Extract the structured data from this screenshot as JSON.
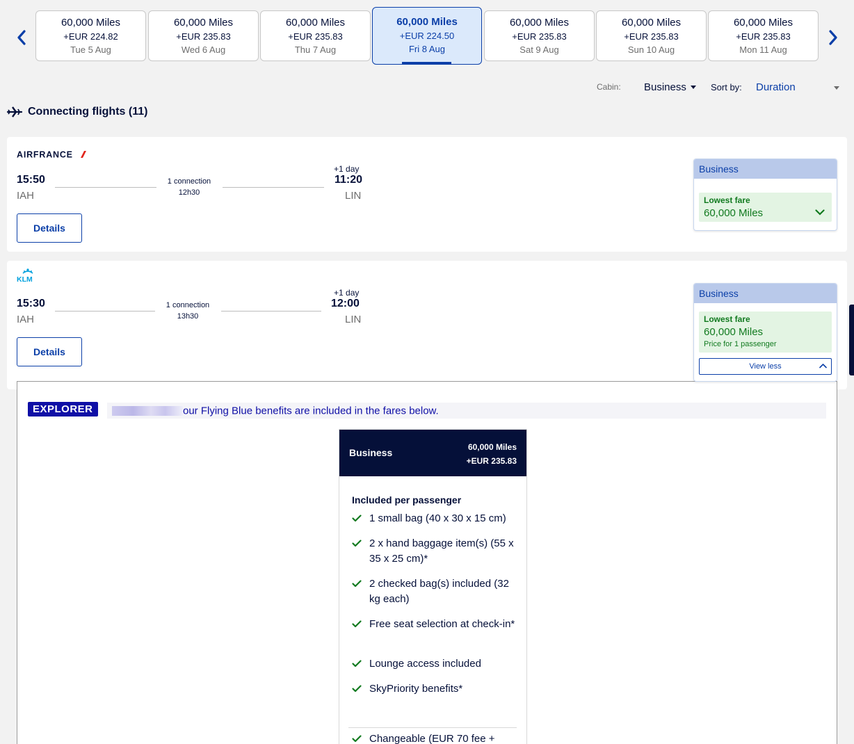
{
  "dates": [
    {
      "miles": "60,000 Miles",
      "eur": "+EUR 224.82",
      "day": "Tue 5 Aug"
    },
    {
      "miles": "60,000 Miles",
      "eur": "+EUR 235.83",
      "day": "Wed 6 Aug"
    },
    {
      "miles": "60,000 Miles",
      "eur": "+EUR 235.83",
      "day": "Thu 7 Aug"
    },
    {
      "miles": "60,000 Miles",
      "eur": "+EUR 224.50",
      "day": "Fri 8 Aug"
    },
    {
      "miles": "60,000 Miles",
      "eur": "+EUR 235.83",
      "day": "Sat 9 Aug"
    },
    {
      "miles": "60,000 Miles",
      "eur": "+EUR 235.83",
      "day": "Sun 10 Aug"
    },
    {
      "miles": "60,000 Miles",
      "eur": "+EUR 235.83",
      "day": "Mon 11 Aug"
    }
  ],
  "controls": {
    "cabin_label": "Cabin:",
    "cabin_value": "Business",
    "sort_label": "Sort by:",
    "sort_value": "Duration"
  },
  "section_title": "Connecting flights (11)",
  "flights": [
    {
      "airline": "AIRFRANCE",
      "dep_time": "15:50",
      "dep_airport": "IAH",
      "arr_time": "11:20",
      "arr_airport": "LIN",
      "plus_day": "+1 day",
      "connection": "1 connection",
      "duration": "12h30",
      "details_label": "Details",
      "cabin": "Business",
      "fare_label": "Lowest fare",
      "fare_value": "60,000 Miles"
    },
    {
      "airline": "KLM",
      "dep_time": "15:30",
      "dep_airport": "IAH",
      "arr_time": "12:00",
      "arr_airport": "LIN",
      "plus_day": "+1 day",
      "connection": "1 connection",
      "duration": "13h30",
      "details_label": "Details",
      "cabin": "Business",
      "fare_label": "Lowest fare",
      "fare_value": "60,000 Miles",
      "fare_sub": "Price for 1 passenger",
      "view_less": "View less"
    }
  ],
  "expanded": {
    "badge": "EXPLORER",
    "benefit_text": "our Flying Blue benefits are included in the fares below.",
    "fare_name": "Business",
    "fare_miles": "60,000 Miles",
    "fare_eur": "+EUR 235.83",
    "included_title": "Included per passenger",
    "items": [
      "1 small bag (40 x 30 x 15 cm)",
      "2 x hand baggage item(s) (55 x 35 x 25 cm)*",
      "2 checked bag(s) included (32 kg each)",
      "Free seat selection at check-in*",
      "Lounge access included",
      "SkyPriority benefits*",
      "Changeable (EUR 70 fee +"
    ]
  },
  "colors": {
    "brand_blue": "#0b3fa8",
    "navy": "#051039",
    "green": "#117a1f",
    "explorer": "#0f0fa6"
  }
}
